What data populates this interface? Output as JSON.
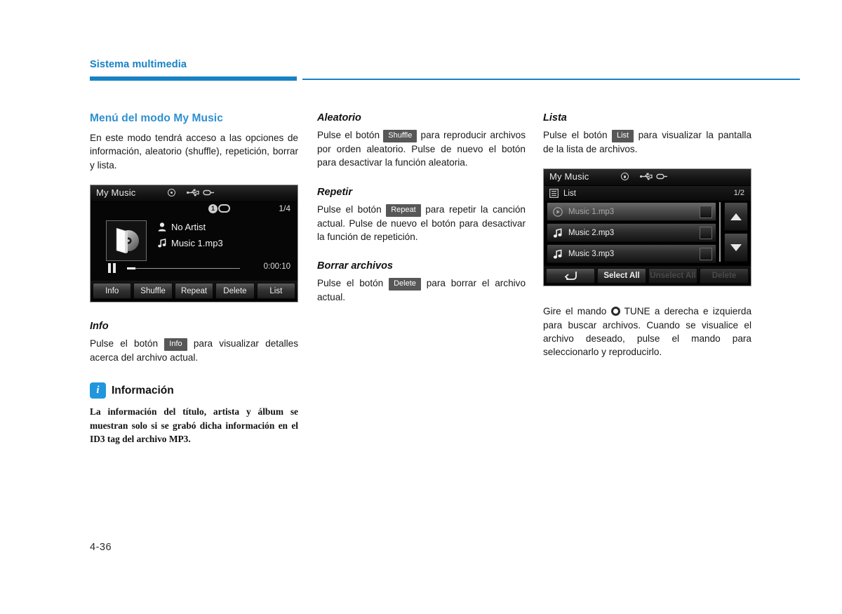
{
  "header": {
    "title": "Sistema multimedia",
    "accent_color": "#1782c4"
  },
  "footer": {
    "page_number": "4-36"
  },
  "column_left": {
    "section_title": "Menú del modo My Music",
    "intro_paragraph": "En este modo tendrá acceso a las opciones de información, aleatorio (shuffle), repetición, borrar y lista.",
    "info": {
      "heading": "Info",
      "text_before": "Pulse el botón",
      "key": "Info",
      "text_after": "para visualizar detalles acerca del archivo actual."
    },
    "note": {
      "icon": "info-icon",
      "icon_glyph": "i",
      "icon_color": "#2196dd",
      "title": "Información",
      "body": "La información del título, artista y álbum se muestran solo si se grabó dicha información en el ID3 tag del archivo MP3."
    }
  },
  "column_mid": {
    "shuffle": {
      "heading": "Aleatorio",
      "text_before": "Pulse el botón",
      "key": "Shuffle",
      "text_after": "para reproducir archivos por orden aleatorio. Pulse de nuevo el botón para desactivar la función aleatoria."
    },
    "repeat": {
      "heading": "Repetir",
      "text_before": "Pulse el botón",
      "key": "Repeat",
      "text_after": "para repetir la canción actual. Pulse de nuevo el botón para desactivar la función de repetición."
    },
    "delete": {
      "heading": "Borrar archivos",
      "text_before": "Pulse el botón",
      "key": "Delete",
      "text_after": "para borrar el archivo actual."
    }
  },
  "column_right": {
    "list": {
      "heading": "Lista",
      "text_before": "Pulse el botón",
      "key": "List",
      "text_after": "para visualizar la pantalla de la lista de archivos."
    },
    "tune_text_1": "Gire el mando",
    "tune_knob_label": "tune-knob-icon",
    "tune_text_2": "TUNE a derecha e izquierda para buscar archivos. Cuando se visualice el archivo deseado, pulse el mando para seleccionarlo y reproducirlo."
  },
  "player_screen": {
    "title": "My Music",
    "status_icons": [
      "disc-icon",
      "usb-icon",
      "device-icon"
    ],
    "repeat_badge": "1",
    "repeat_badge_icon": "repeat-one-icon",
    "track_count": "1/4",
    "album_art": "cd-case-icon",
    "artist_icon": "person-icon",
    "artist": "No Artist",
    "track_icon": "music-note-icon",
    "track": "Music 1.mp3",
    "playback_state_icon": "pause-icon",
    "elapsed_time": "0:00:10",
    "buttons": [
      "Info",
      "Shuffle",
      "Repeat",
      "Delete",
      "List"
    ]
  },
  "list_screen": {
    "title": "My Music",
    "status_icons": [
      "disc-icon",
      "usb-icon",
      "device-icon"
    ],
    "list_icon": "list-icon",
    "list_label": "List",
    "page_indicator": "1/2",
    "rows": [
      {
        "icon": "play-icon",
        "label": "Music 1.mp3",
        "playing": true
      },
      {
        "icon": "music-note-icon",
        "label": "Music 2.mp3",
        "playing": false
      },
      {
        "icon": "music-note-icon",
        "label": "Music 3.mp3",
        "playing": false
      }
    ],
    "scroll_up_icon": "arrow-up-icon",
    "scroll_down_icon": "arrow-down-icon",
    "buttons": [
      {
        "label": "",
        "icon": "back-arrow-icon",
        "disabled": false
      },
      {
        "label": "Select All",
        "disabled": false
      },
      {
        "label": "Unselect All",
        "disabled": true
      },
      {
        "label": "Delete",
        "disabled": true
      }
    ]
  }
}
